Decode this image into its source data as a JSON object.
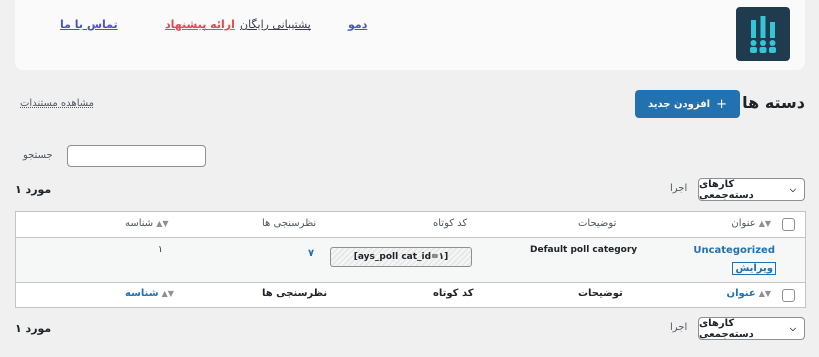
{
  "top_links": {
    "contact": "تماس با ما",
    "offer": "ارائه پیشنهاد",
    "support": "پشتیبانی رایگان",
    "demo": "دمو"
  },
  "page": {
    "title": "دسته ها",
    "add_new_label": "افزودن جدید",
    "docs_link": "مشاهده مستندات"
  },
  "search": {
    "label": "جستجو",
    "value": ""
  },
  "bulk": {
    "select_label": "کارهای دسته‌جمعی",
    "apply_label": "اجرا",
    "item_count": "۱ مورد"
  },
  "table": {
    "columns": {
      "title": "عنوان",
      "description": "توضیحات",
      "shortcode": "کد کوتاه",
      "polls": "نظرسنجی ها",
      "id": "شناسه"
    },
    "rows": [
      {
        "title": "Uncategorized",
        "edit_link": "ویرایش",
        "description": "Default poll category",
        "shortcode": "[ays_poll cat_id=۱]",
        "polls": "۷",
        "id": "۱"
      }
    ]
  },
  "colors": {
    "primary": "#2271b1",
    "logo_bg": "#1f3b4d",
    "logo_fg": "#34c6d8",
    "offer_link": "#e5484d"
  }
}
